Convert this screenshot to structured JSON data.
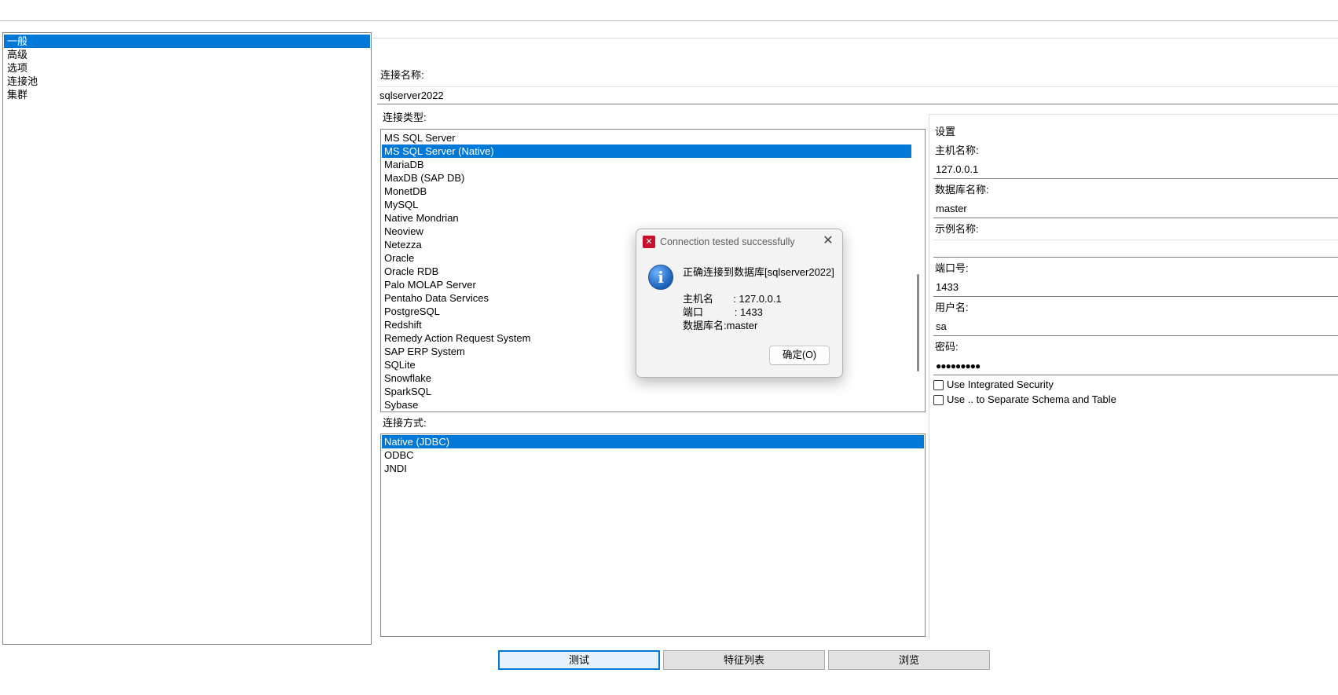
{
  "nav": {
    "items": [
      {
        "label": "一般",
        "selected": true
      },
      {
        "label": "高级",
        "selected": false
      },
      {
        "label": "选项",
        "selected": false
      },
      {
        "label": "连接池",
        "selected": false
      },
      {
        "label": "集群",
        "selected": false
      }
    ]
  },
  "connection_name": {
    "label": "连接名称:",
    "value": "sqlserver2022"
  },
  "connection_type": {
    "label": "连接类型:",
    "items": [
      "MS SQL Server",
      "MS SQL Server (Native)",
      "MariaDB",
      "MaxDB (SAP DB)",
      "MonetDB",
      "MySQL",
      "Native Mondrian",
      "Neoview",
      "Netezza",
      "Oracle",
      "Oracle RDB",
      "Palo MOLAP Server",
      "Pentaho Data Services",
      "PostgreSQL",
      "Redshift",
      "Remedy Action Request System",
      "SAP ERP System",
      "SQLite",
      "Snowflake",
      "SparkSQL",
      "Sybase"
    ],
    "selected": "MS SQL Server (Native)"
  },
  "access": {
    "label": "连接方式:",
    "items": [
      "Native (JDBC)",
      "ODBC",
      "JNDI"
    ],
    "selected": "Native (JDBC)"
  },
  "settings": {
    "title": "设置",
    "host_label": "主机名称:",
    "host_value": "127.0.0.1",
    "db_label": "数据库名称:",
    "db_value": "master",
    "instance_label": "示例名称:",
    "instance_value": "",
    "port_label": "端口号:",
    "port_value": "1433",
    "user_label": "用户名:",
    "user_value": "sa",
    "password_label": "密码:",
    "password_value": "●●●●●●●●●",
    "integrated_security_label": "Use Integrated Security",
    "separate_schema_label": "Use .. to Separate Schema and Table"
  },
  "buttons": {
    "test": "测试",
    "features": "特征列表",
    "explore": "浏览"
  },
  "dialog": {
    "title": "Connection tested successfully",
    "message": "正确连接到数据库[sqlserver2022]",
    "host_line": "主机名       : 127.0.0.1",
    "port_line": "端口           : 1433",
    "db_line": "数据库名:master",
    "ok_label": "确定(O)"
  },
  "colors": {
    "selection": "#0078d7",
    "app_icon": "#c8102e"
  }
}
